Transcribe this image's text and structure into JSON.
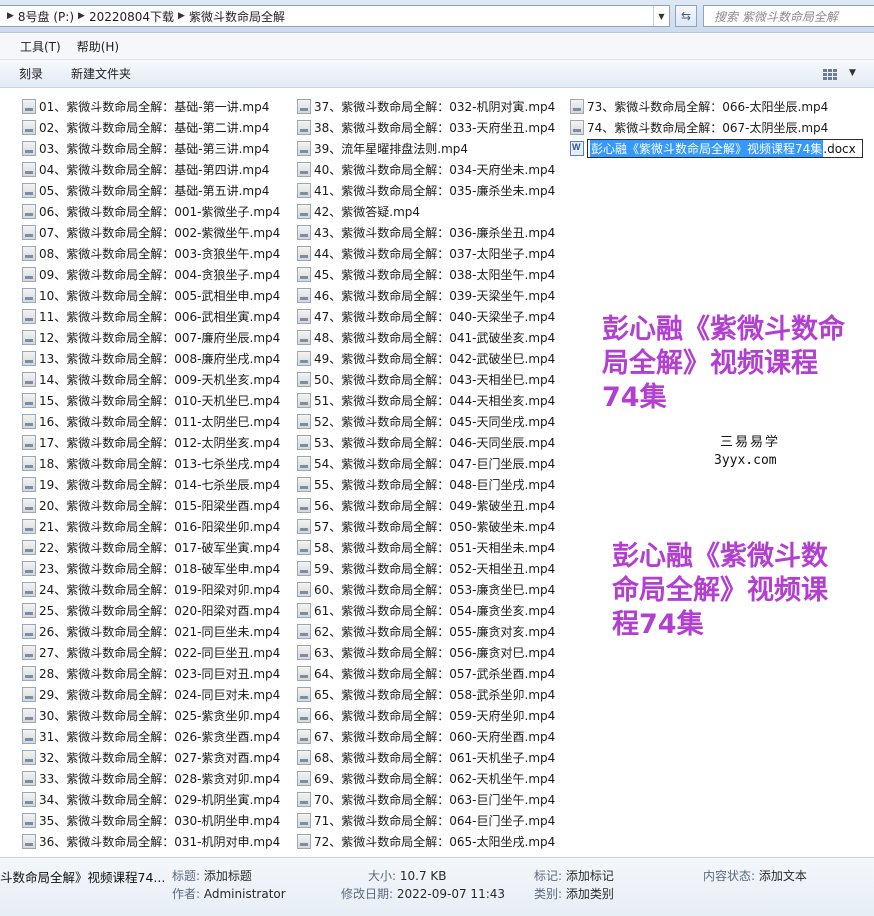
{
  "address": {
    "segments": [
      "8号盘 (P:)",
      "20220804下载",
      "紫微斗数命局全解"
    ],
    "search_placeholder": "搜索 紫微斗数命局全解"
  },
  "menu": [
    "工具(T)",
    "帮助(H)"
  ],
  "toolbar": {
    "burn": "刻录",
    "new_folder": "新建文件夹"
  },
  "files": {
    "col1": [
      "01、紫微斗数命局全解：基础-第一讲.mp4",
      "02、紫微斗数命局全解：基础-第二讲.mp4",
      "03、紫微斗数命局全解：基础-第三讲.mp4",
      "04、紫微斗数命局全解：基础-第四讲.mp4",
      "05、紫微斗数命局全解：基础-第五讲.mp4",
      "06、紫微斗数命局全解：001-紫微坐子.mp4",
      "07、紫微斗数命局全解：002-紫微坐午.mp4",
      "08、紫微斗数命局全解：003-贪狼坐午.mp4",
      "09、紫微斗数命局全解：004-贪狼坐子.mp4",
      "10、紫微斗数命局全解：005-武相坐申.mp4",
      "11、紫微斗数命局全解：006-武相坐寅.mp4",
      "12、紫微斗数命局全解：007-廉府坐辰.mp4",
      "13、紫微斗数命局全解：008-廉府坐戌.mp4",
      "14、紫微斗数命局全解：009-天机坐亥.mp4",
      "15、紫微斗数命局全解：010-天机坐巳.mp4",
      "16、紫微斗数命局全解：011-太阴坐巳.mp4",
      "17、紫微斗数命局全解：012-太阴坐亥.mp4",
      "18、紫微斗数命局全解：013-七杀坐戌.mp4",
      "19、紫微斗数命局全解：014-七杀坐辰.mp4",
      "20、紫微斗数命局全解：015-阳梁坐酉.mp4",
      "21、紫微斗数命局全解：016-阳梁坐卯.mp4",
      "22、紫微斗数命局全解：017-破军坐寅.mp4",
      "23、紫微斗数命局全解：018-破军坐申.mp4",
      "24、紫微斗数命局全解：019-阳梁对卯.mp4",
      "25、紫微斗数命局全解：020-阳梁对酉.mp4",
      "26、紫微斗数命局全解：021-同巨坐未.mp4",
      "27、紫微斗数命局全解：022-同巨坐丑.mp4",
      "28、紫微斗数命局全解：023-同巨对丑.mp4",
      "29、紫微斗数命局全解：024-同巨对未.mp4",
      "30、紫微斗数命局全解：025-紫贪坐卯.mp4",
      "31、紫微斗数命局全解：026-紫贪坐酉.mp4",
      "32、紫微斗数命局全解：027-紫贪对酉.mp4",
      "33、紫微斗数命局全解：028-紫贪对卯.mp4",
      "34、紫微斗数命局全解：029-机阴坐寅.mp4",
      "35、紫微斗数命局全解：030-机阴坐申.mp4",
      "36、紫微斗数命局全解：031-机阴对申.mp4"
    ],
    "col2": [
      "37、紫微斗数命局全解：032-机阴对寅.mp4",
      "38、紫微斗数命局全解：033-天府坐丑.mp4",
      "39、流年星曜排盘法则.mp4",
      "40、紫微斗数命局全解：034-天府坐未.mp4",
      "41、紫微斗数命局全解：035-廉杀坐未.mp4",
      "42、紫微答疑.mp4",
      "43、紫微斗数命局全解：036-廉杀坐丑.mp4",
      "44、紫微斗数命局全解：037-太阳坐子.mp4",
      "45、紫微斗数命局全解：038-太阳坐午.mp4",
      "46、紫微斗数命局全解：039-天梁坐午.mp4",
      "47、紫微斗数命局全解：040-天梁坐子.mp4",
      "48、紫微斗数命局全解：041-武破坐亥.mp4",
      "49、紫微斗数命局全解：042-武破坐巳.mp4",
      "50、紫微斗数命局全解：043-天相坐巳.mp4",
      "51、紫微斗数命局全解：044-天相坐亥.mp4",
      "52、紫微斗数命局全解：045-天同坐戌.mp4",
      "53、紫微斗数命局全解：046-天同坐辰.mp4",
      "54、紫微斗数命局全解：047-巨门坐辰.mp4",
      "55、紫微斗数命局全解：048-巨门坐戌.mp4",
      "56、紫微斗数命局全解：049-紫破坐丑.mp4",
      "57、紫微斗数命局全解：050-紫破坐未.mp4",
      "58、紫微斗数命局全解：051-天相坐未.mp4",
      "59、紫微斗数命局全解：052-天相坐丑.mp4",
      "60、紫微斗数命局全解：053-廉贪坐巳.mp4",
      "61、紫微斗数命局全解：054-廉贪坐亥.mp4",
      "62、紫微斗数命局全解：055-廉贪对亥.mp4",
      "63、紫微斗数命局全解：056-廉贪对巳.mp4",
      "64、紫微斗数命局全解：057-武杀坐酉.mp4",
      "65、紫微斗数命局全解：058-武杀坐卯.mp4",
      "66、紫微斗数命局全解：059-天府坐卯.mp4",
      "67、紫微斗数命局全解：060-天府坐酉.mp4",
      "68、紫微斗数命局全解：061-天机坐子.mp4",
      "69、紫微斗数命局全解：062-天机坐午.mp4",
      "70、紫微斗数命局全解：063-巨门坐午.mp4",
      "71、紫微斗数命局全解：064-巨门坐子.mp4",
      "72、紫微斗数命局全解：065-太阳坐戌.mp4"
    ],
    "col3": [
      "73、紫微斗数命局全解：066-太阳坐辰.mp4",
      "74、紫微斗数命局全解：067-太阴坐辰.mp4"
    ],
    "renaming": {
      "selected": "彭心融《紫微斗数命局全解》视频课程74集",
      "extension": ".docx"
    }
  },
  "overlay": {
    "promo1": [
      "彭心融《紫微斗数命",
      "局全解》视频课程",
      "74集"
    ],
    "promo2": [
      "彭心融《紫微斗数",
      "命局全解》视频课",
      "程74集"
    ],
    "stamp_line1": "三易易学",
    "stamp_line2": "3yyx.com",
    "promo_color": "#b23fd0"
  },
  "details": {
    "filename": "斗数命局全解》视频课程74...",
    "title_label": "标题:",
    "title_value": "添加标题",
    "author_label": "作者:",
    "author_value": "Administrator",
    "size_label": "大小:",
    "size_value": "10.7 KB",
    "modified_label": "修改日期:",
    "modified_value": "2022-09-07 11:43",
    "tags_label": "标记:",
    "tags_value": "添加标记",
    "category_label": "类别:",
    "category_value": "添加类别",
    "content_status_label": "内容状态:",
    "content_status_value": "添加文本"
  }
}
